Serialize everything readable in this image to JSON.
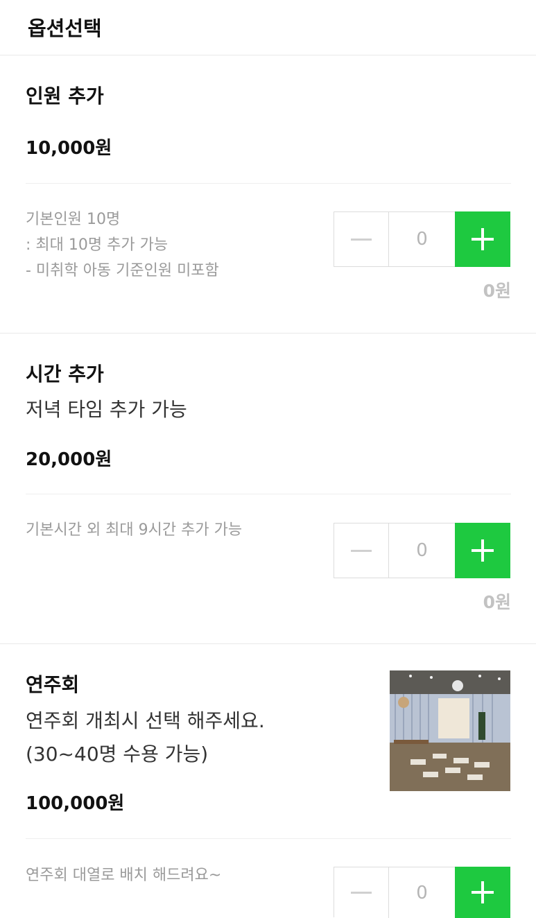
{
  "header": {
    "title": "옵션선택"
  },
  "options": [
    {
      "title": "인원 추가",
      "price": "10,000원",
      "desc_lines": [
        "기본인원 10명",
        ": 최대 10명 추가 가능",
        "- 미취학 아동 기준인원 미포함"
      ],
      "quantity": "0",
      "subtotal": "0원"
    },
    {
      "title": "시간 추가",
      "subtitle": "저녁 타임 추가 가능",
      "price": "20,000원",
      "desc_lines": [
        "기본시간 외 최대 9시간 추가 가능"
      ],
      "quantity": "0",
      "subtotal": "0원"
    },
    {
      "title": "연주회",
      "subtitle_lines": [
        "연주회 개최시 선택 해주세요.",
        "(30~40명 수용 가능)"
      ],
      "price": "100,000원",
      "desc_lines": [
        "연주회 대열로 배치 해드려요~"
      ],
      "quantity": "0",
      "image": "venue-photo"
    }
  ],
  "colors": {
    "accent": "#1ec940",
    "muted": "#9a9a9a",
    "divider": "#e9e9e9"
  },
  "icons": {
    "decrement": "minus-icon",
    "increment": "plus-icon"
  }
}
